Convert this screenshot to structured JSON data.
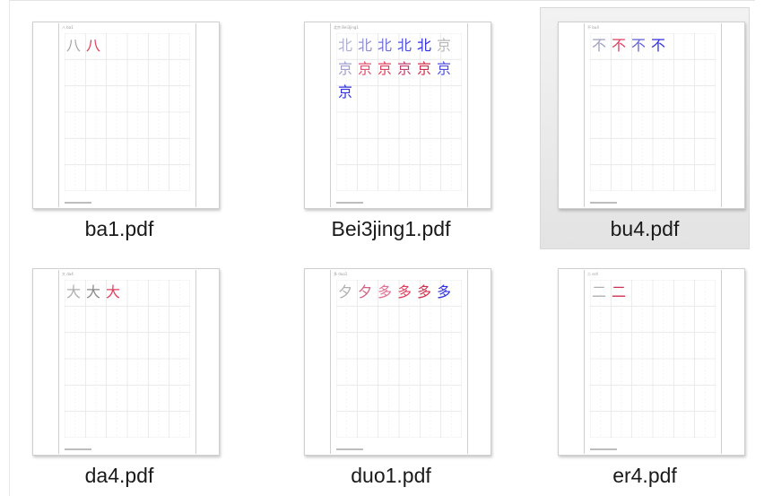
{
  "files": [
    {
      "name": "ba1.pdf",
      "header": "八 ba1",
      "chars": [
        {
          "ch": "八",
          "color": "#a8a8a8"
        },
        {
          "ch": "八",
          "color": "#e04060"
        }
      ]
    },
    {
      "name": "Bei3jing1.pdf",
      "header": "北京 Bei3jing1",
      "chars": [
        {
          "ch": "北",
          "color": "#b0b0d0"
        },
        {
          "ch": "北",
          "color": "#9090d0"
        },
        {
          "ch": "北",
          "color": "#7070d8"
        },
        {
          "ch": "北",
          "color": "#5050e0"
        },
        {
          "ch": "北",
          "color": "#3030e0"
        },
        {
          "ch": "京",
          "color": "#b8b8b8"
        },
        {
          "ch": "京",
          "color": "#a0a0d0"
        },
        {
          "ch": "京",
          "color": "#e05070"
        },
        {
          "ch": "京",
          "color": "#e04060"
        },
        {
          "ch": "京",
          "color": "#c04070"
        },
        {
          "ch": "京",
          "color": "#d03050"
        },
        {
          "ch": "京",
          "color": "#5050e0"
        },
        {
          "ch": "京",
          "color": "#3030e0"
        }
      ]
    },
    {
      "name": "bu4.pdf",
      "header": "不 bu4",
      "chars": [
        {
          "ch": "不",
          "color": "#a0a0c0"
        },
        {
          "ch": "不",
          "color": "#e04060"
        },
        {
          "ch": "不",
          "color": "#6060d8"
        },
        {
          "ch": "不",
          "color": "#3030e0"
        }
      ]
    },
    {
      "name": "da4.pdf",
      "header": "大 da4",
      "chars": [
        {
          "ch": "大",
          "color": "#b0b0b0"
        },
        {
          "ch": "大",
          "color": "#8a8a8a"
        },
        {
          "ch": "大",
          "color": "#e04060"
        }
      ]
    },
    {
      "name": "duo1.pdf",
      "header": "多 duo1",
      "chars": [
        {
          "ch": "夕",
          "color": "#b0b0b0"
        },
        {
          "ch": "夕",
          "color": "#d06080"
        },
        {
          "ch": "多",
          "color": "#e07090"
        },
        {
          "ch": "多",
          "color": "#e04060"
        },
        {
          "ch": "多",
          "color": "#d03050"
        },
        {
          "ch": "多",
          "color": "#3030e0"
        }
      ]
    },
    {
      "name": "er4.pdf",
      "header": "二 er4",
      "chars": [
        {
          "ch": "二",
          "color": "#b0b0b0"
        },
        {
          "ch": "二",
          "color": "#d03050"
        }
      ]
    }
  ],
  "selected": "bu4.pdf"
}
